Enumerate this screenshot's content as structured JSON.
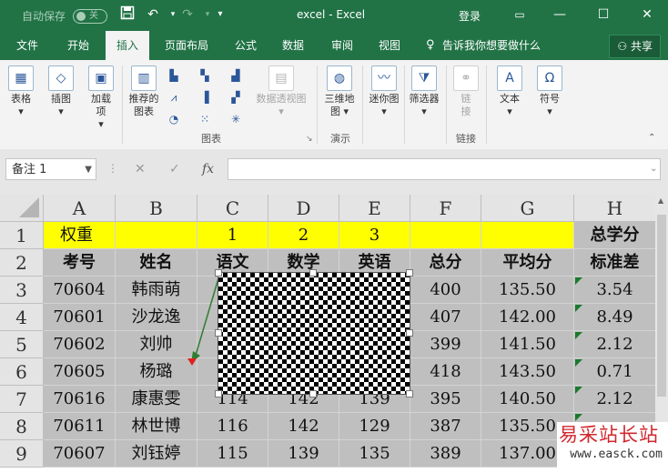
{
  "titlebar": {
    "autosave_label": "自动保存",
    "autosave_state": "关",
    "title": "excel  -  Excel",
    "login": "登录"
  },
  "tabs": [
    "文件",
    "开始",
    "插入",
    "页面布局",
    "公式",
    "数据",
    "审阅",
    "视图"
  ],
  "tell_me": "告诉我你想要做什么",
  "share": "共享",
  "ribbon": {
    "table": "表格",
    "illustrations": "插图",
    "addins_1": "加载",
    "addins_2": "项",
    "rec_charts_1": "推荐的",
    "rec_charts_2": "图表",
    "pivot_chart": "数据透视图",
    "map3d_1": "三维地",
    "map3d_2": "图",
    "sparkline": "迷你图",
    "filter": "筛选器",
    "link_1": "链",
    "link_2": "接",
    "text": "文本",
    "symbol": "符号",
    "group_charts": "图表",
    "group_tour": "演示",
    "group_links": "链接"
  },
  "formula_bar": {
    "name_box": "备注 1",
    "fx": "fx",
    "value": ""
  },
  "sheet": {
    "columns": [
      "A",
      "B",
      "C",
      "D",
      "E",
      "F",
      "G",
      "H"
    ],
    "rows": [
      "1",
      "2",
      "3",
      "4",
      "5",
      "6",
      "7",
      "8",
      "9"
    ],
    "r1": {
      "a": "权重",
      "c": "1",
      "d": "2",
      "e": "3",
      "h": "总学分"
    },
    "r2": {
      "a": "考号",
      "b": "姓名",
      "c": "语文",
      "d": "数学",
      "e": "英语",
      "f": "总分",
      "g": "平均分",
      "h": "标准差"
    },
    "data": [
      {
        "a": "70604",
        "b": "韩雨萌",
        "c": "",
        "d": "",
        "e": "",
        "f": "400",
        "g": "135.50",
        "h": "3.54"
      },
      {
        "a": "70601",
        "b": "沙龙逸",
        "c": "",
        "d": "",
        "e": "",
        "f": "407",
        "g": "142.00",
        "h": "8.49"
      },
      {
        "a": "70602",
        "b": "刘帅",
        "c": "",
        "d": "",
        "e": "",
        "f": "399",
        "g": "141.50",
        "h": "2.12"
      },
      {
        "a": "70605",
        "b": "杨璐",
        "c": "",
        "d": "",
        "e": "",
        "f": "418",
        "g": "143.50",
        "h": "0.71"
      },
      {
        "a": "70616",
        "b": "康惠雯",
        "c": "114",
        "d": "142",
        "e": "139",
        "f": "395",
        "g": "140.50",
        "h": "2.12"
      },
      {
        "a": "70611",
        "b": "林世博",
        "c": "116",
        "d": "142",
        "e": "129",
        "f": "387",
        "g": "135.50",
        "h": ""
      },
      {
        "a": "70607",
        "b": "刘钰婷",
        "c": "115",
        "d": "139",
        "e": "135",
        "f": "389",
        "g": "137.00",
        "h": ""
      }
    ]
  },
  "watermark": {
    "line1": "易采站长站",
    "line2": "www.easck.com"
  }
}
